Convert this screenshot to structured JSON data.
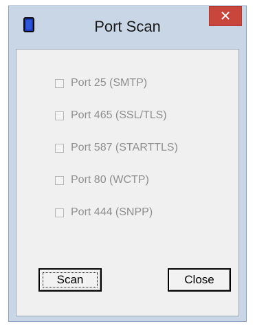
{
  "window": {
    "title": "Port Scan",
    "close_glyph": "✕",
    "app_icon": "application-icon"
  },
  "ports": [
    {
      "label": "Port 25 (SMTP)",
      "checked": false,
      "enabled": false
    },
    {
      "label": "Port 465 (SSL/TLS)",
      "checked": false,
      "enabled": false
    },
    {
      "label": "Port 587 (STARTTLS)",
      "checked": false,
      "enabled": false
    },
    {
      "label": "Port 80 (WCTP)",
      "checked": false,
      "enabled": false
    },
    {
      "label": "Port 444 (SNPP)",
      "checked": false,
      "enabled": false
    }
  ],
  "buttons": {
    "scan_label": "Scan",
    "close_label": "Close"
  },
  "colors": {
    "close_button": "#c9463d",
    "frame": "#c9d6e5",
    "disabled_text": "#8e8e8e"
  }
}
